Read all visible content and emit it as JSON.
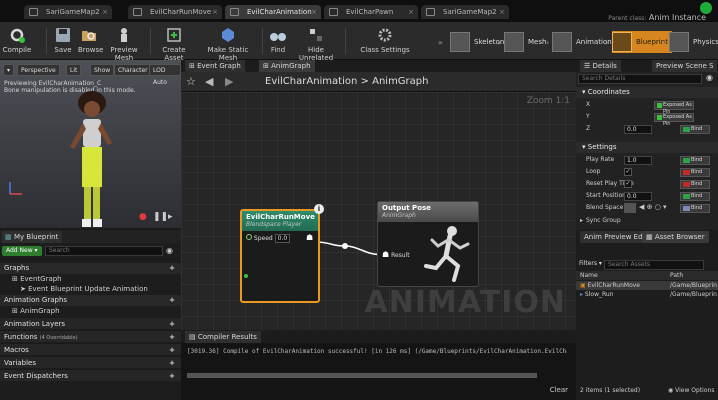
{
  "tabs": [
    {
      "label": "SariGameMap2",
      "active": false
    },
    {
      "label": "EvilCharRunMove",
      "active": false
    },
    {
      "label": "EvilCharAnimation",
      "active": true
    },
    {
      "label": "EvilCharPawn",
      "active": false
    },
    {
      "label": "SariGameMap2",
      "active": false
    }
  ],
  "parent_class": {
    "label": "Parent class:",
    "value": "Anim Instance"
  },
  "toolbar": {
    "compile": "Compile",
    "save": "Save",
    "browse": "Browse",
    "preview_mesh": "Preview Mesh",
    "create_asset": "Create Asset",
    "make_static_mesh": "Make Static Mesh",
    "find": "Find",
    "hide_unrelated": "Hide Unrelated",
    "class_settings": "Class Settings",
    "modes": [
      "Skeleton",
      "Mesh",
      "Animation",
      "Blueprint",
      "Physics"
    ],
    "active_mode": "Blueprint"
  },
  "viewport": {
    "perspective": "Perspective",
    "lit": "Lit",
    "show": "Show",
    "character": "Character",
    "lod": "LOD Auto",
    "preview_line1": "Previewing EvilCharAnimation_C",
    "preview_line2": "Bone manipulation is disabled in this mode."
  },
  "my_blueprint": {
    "tab": "My Blueprint",
    "add_new": "Add New",
    "search_placeholder": "Search",
    "graphs_header": "Graphs",
    "graphs": [
      "EventGraph",
      "Event Blueprint Update Animation"
    ],
    "anim_graphs_header": "Animation Graphs",
    "anim_graphs": [
      "AnimGraph"
    ],
    "sections": [
      {
        "label": "Animation Layers",
        "note": ""
      },
      {
        "label": "Functions",
        "note": "(4 Overridable)"
      },
      {
        "label": "Macros",
        "note": ""
      },
      {
        "label": "Variables",
        "note": ""
      },
      {
        "label": "Event Dispatchers",
        "note": ""
      }
    ]
  },
  "graph": {
    "tabs": [
      "Event Graph",
      "AnimGraph"
    ],
    "breadcrumb_root": "EvilCharAnimation",
    "breadcrumb_sep": ">",
    "breadcrumb_leaf": "AnimGraph",
    "zoom": "Zoom 1:1",
    "watermark": "ANIMATION",
    "blendspace_node": {
      "title": "EvilCharRunMove",
      "subtitle": "Blendspace Player",
      "pin_label": "Speed",
      "pin_value": "0.0"
    },
    "output_node": {
      "title": "Output Pose",
      "subtitle": "AnimGraph",
      "pin_label": "Result"
    }
  },
  "compiler": {
    "tab": "Compiler Results",
    "line": "[3019.36] Compile of EvilCharAnimation successful! [in 126 ms] (/Game/Blueprints/EvilCharAnimation.EvilCha",
    "clear": "Clear"
  },
  "details": {
    "tab": "Details",
    "tab2": "Preview Scene S",
    "search_placeholder": "Search Details",
    "coordinates_header": "Coordinates",
    "coords": [
      {
        "label": "X",
        "pin": "Exposed As Pin"
      },
      {
        "label": "Y",
        "pin": "Exposed As Pin"
      },
      {
        "label": "Z",
        "value": "0.0",
        "bind": "Bind"
      }
    ],
    "settings_header": "Settings",
    "settings": [
      {
        "label": "Play Rate",
        "value": "1.0",
        "bind": "Bind"
      },
      {
        "label": "Loop",
        "check": "✓",
        "bind": "Bind"
      },
      {
        "label": "Reset Play Time",
        "check": "✓",
        "bind": "Bind"
      },
      {
        "label": "Start Position",
        "value": "0.0",
        "bind": "Bind"
      },
      {
        "label": "Blend Space",
        "bind": "Bind"
      },
      {
        "label": "Sync Group"
      }
    ]
  },
  "anim_preview": {
    "tab": "Anim Preview Edito",
    "tab2": "Asset Browser",
    "filters": "Filters",
    "search_placeholder": "Search Assets",
    "col_name": "Name",
    "col_path": "Path",
    "rows": [
      {
        "name": "EvilCharRunMove",
        "path": "/Game/Blueprin",
        "selected": true
      },
      {
        "name": "Slow_Run",
        "path": "/Game/Blueprin",
        "selected": false
      }
    ],
    "status": "2 items (1 selected)",
    "view_options": "View Options"
  },
  "colors": {
    "accent": "#d7851f",
    "blendspace_header": "#2f8c6b",
    "selection": "#e79a1f"
  }
}
